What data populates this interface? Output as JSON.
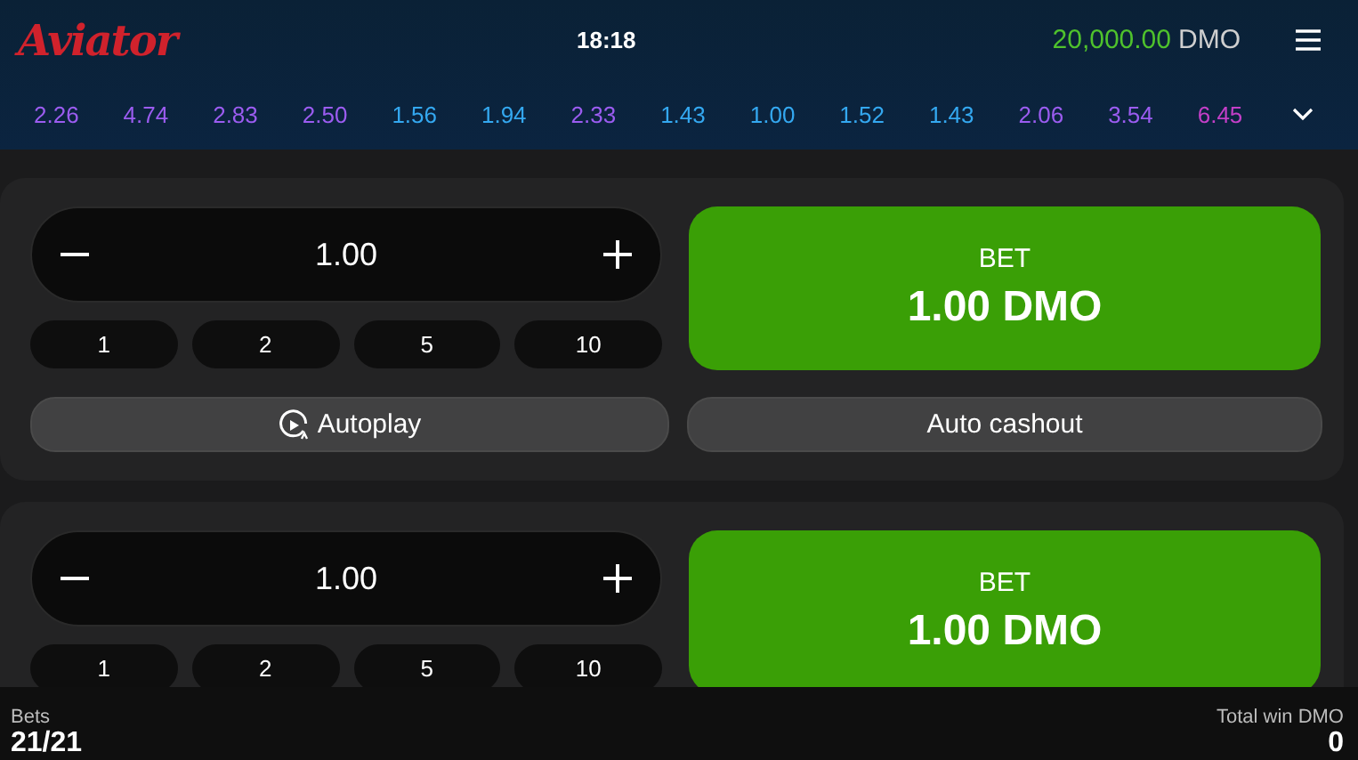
{
  "header": {
    "logo": "Aviator",
    "time": "18:18",
    "balance": {
      "amount": "20,000.00",
      "currency": "DMO"
    }
  },
  "multipliers": [
    {
      "value": "2.26",
      "color": "#9b5cf0"
    },
    {
      "value": "4.74",
      "color": "#9b5cf0"
    },
    {
      "value": "2.83",
      "color": "#9b5cf0"
    },
    {
      "value": "2.50",
      "color": "#9b5cf0"
    },
    {
      "value": "1.56",
      "color": "#34a8f0"
    },
    {
      "value": "1.94",
      "color": "#34a8f0"
    },
    {
      "value": "2.33",
      "color": "#9b5cf0"
    },
    {
      "value": "1.43",
      "color": "#34a8f0"
    },
    {
      "value": "1.00",
      "color": "#34a8f0"
    },
    {
      "value": "1.52",
      "color": "#34a8f0"
    },
    {
      "value": "1.43",
      "color": "#34a8f0"
    },
    {
      "value": "2.06",
      "color": "#9b5cf0"
    },
    {
      "value": "3.54",
      "color": "#9b5cf0"
    },
    {
      "value": "6.45",
      "color": "#c43fc8"
    }
  ],
  "bet_panels": [
    {
      "stake": "1.00",
      "quick_amounts": [
        "1",
        "2",
        "5",
        "10"
      ],
      "bet_label": "BET",
      "bet_amount": "1.00 DMO",
      "modes": [
        {
          "kind": "autoplay",
          "label": "Autoplay"
        },
        {
          "kind": "plain",
          "label": "Auto cashout"
        }
      ]
    },
    {
      "stake": "1.00",
      "quick_amounts": [
        "1",
        "2",
        "5",
        "10"
      ],
      "bet_label": "BET",
      "bet_amount": "1.00 DMO"
    }
  ],
  "footer": {
    "bets_label": "Bets",
    "bets_value": "21/21",
    "win_label": "Total win DMO",
    "win_value": "0"
  }
}
